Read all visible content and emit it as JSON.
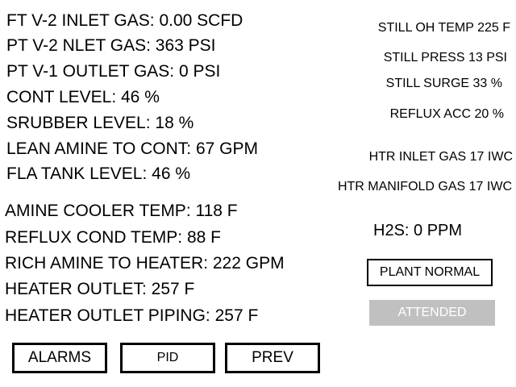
{
  "left_top": [
    "FT V-2 INLET GAS: 0.00 SCFD",
    "PT V-2 NLET GAS: 363 PSI",
    "PT V-1 OUTLET GAS: 0 PSI",
    "CONT LEVEL: 46 %",
    "SRUBBER LEVEL: 18 %",
    "LEAN AMINE TO CONT: 67 GPM",
    "FLA TANK LEVEL: 46 %"
  ],
  "left_bottom": [
    "AMINE COOLER TEMP: 118 F",
    "REFLUX COND TEMP: 88 F",
    "RICH AMINE TO HEATER: 222 GPM",
    "HEATER OUTLET: 257 F",
    "HEATER OUTLET PIPING: 257 F"
  ],
  "right": [
    "STILL OH TEMP 225 F",
    "STILL PRESS 13 PSI",
    "STILL SURGE 33 %",
    "REFLUX ACC 20 %",
    "HTR INLET GAS 17 IWC",
    "HTR MANIFOLD GAS 17 IWC"
  ],
  "h2s": "H2S:  0 PPM",
  "status": "PLANT NORMAL",
  "attended": "ATTENDED",
  "buttons": {
    "alarms": "ALARMS",
    "pid": "PID",
    "prev": "PREV"
  },
  "colors": {
    "background": "#ffffff",
    "text": "#000000",
    "attended_bg": "#c0c0c0",
    "attended_text": "#ffffff"
  }
}
